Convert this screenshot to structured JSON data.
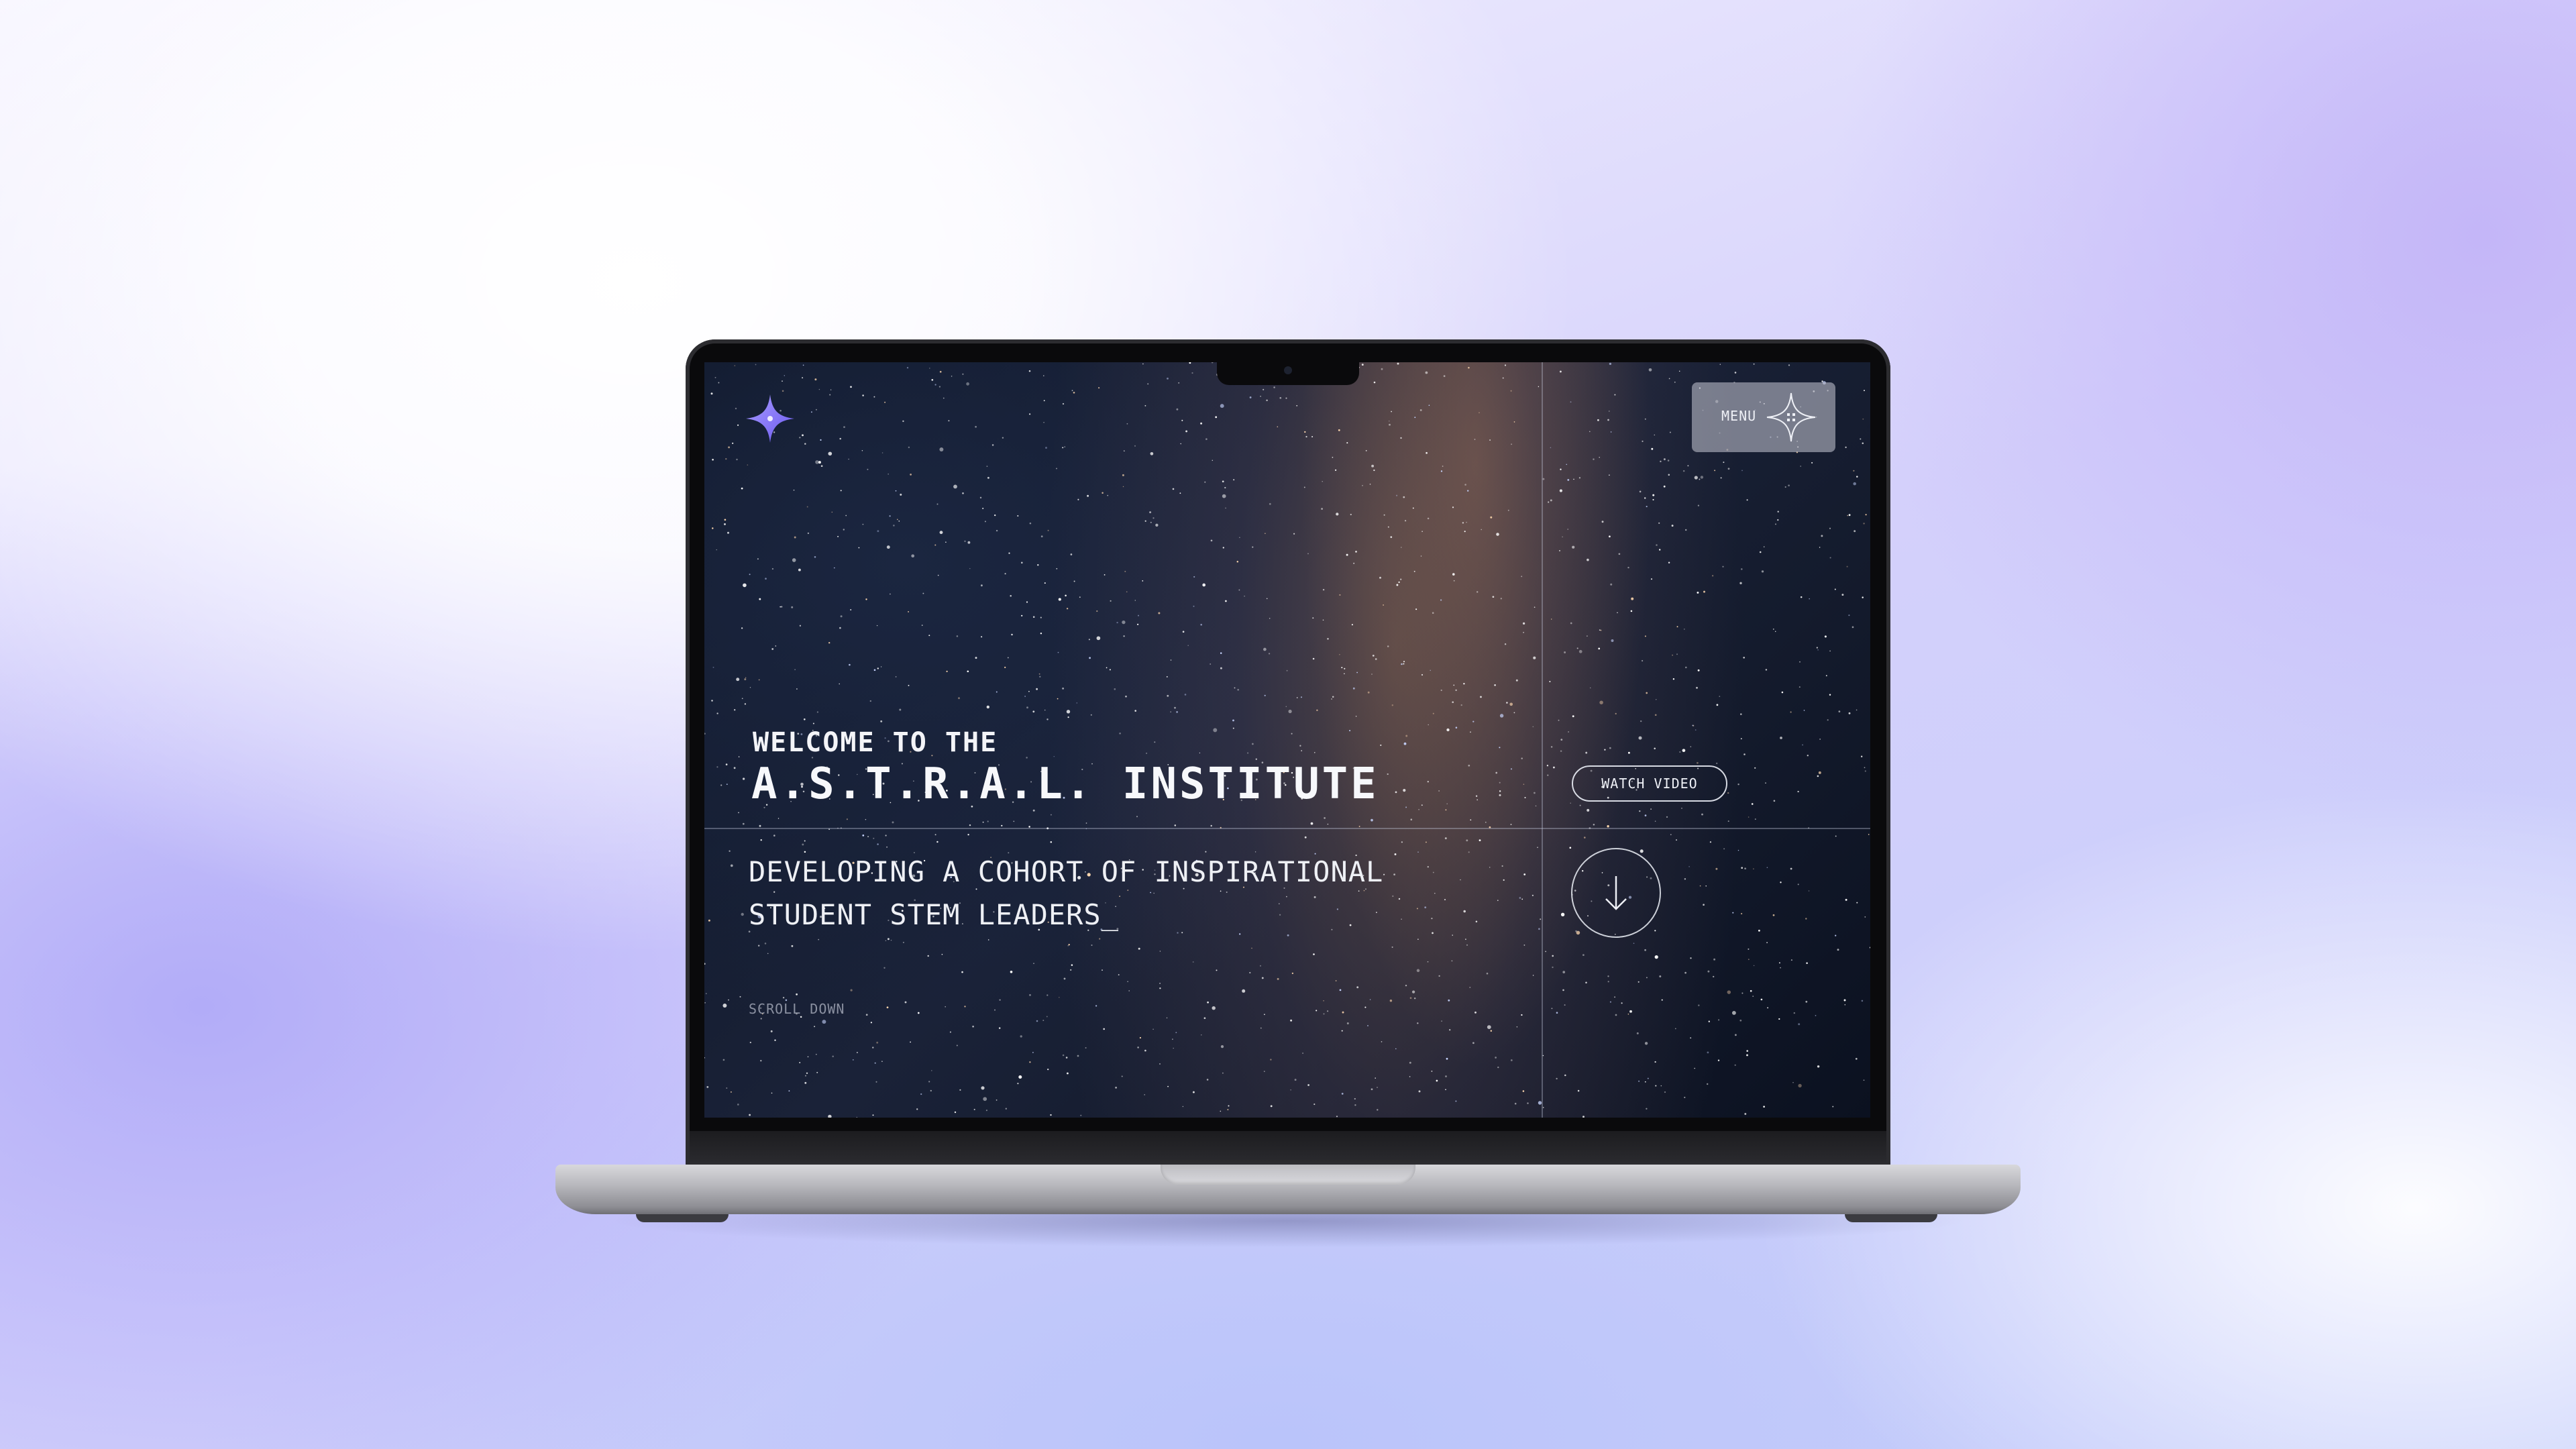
{
  "hero": {
    "welcome": "WELCOME TO THE",
    "title": "A.S.T.R.A.L. INSTITUTE",
    "subtitle_line1": "DEVELOPING A COHORT OF INSPIRATIONAL",
    "subtitle_line2": "STUDENT STEM LEADERS_",
    "scroll_hint": "SCROLL DOWN"
  },
  "header": {
    "menu_label": "MENU",
    "logo_icon": "four-point-star-icon",
    "menu_icon": "sparkle-grid-icon"
  },
  "actions": {
    "watch_video_label": "WATCH VIDEO",
    "scroll_down_icon": "arrow-down-icon"
  },
  "colors": {
    "accent": "#7b6cf6",
    "text": "#f3f4f8",
    "background": "#141b2d"
  }
}
